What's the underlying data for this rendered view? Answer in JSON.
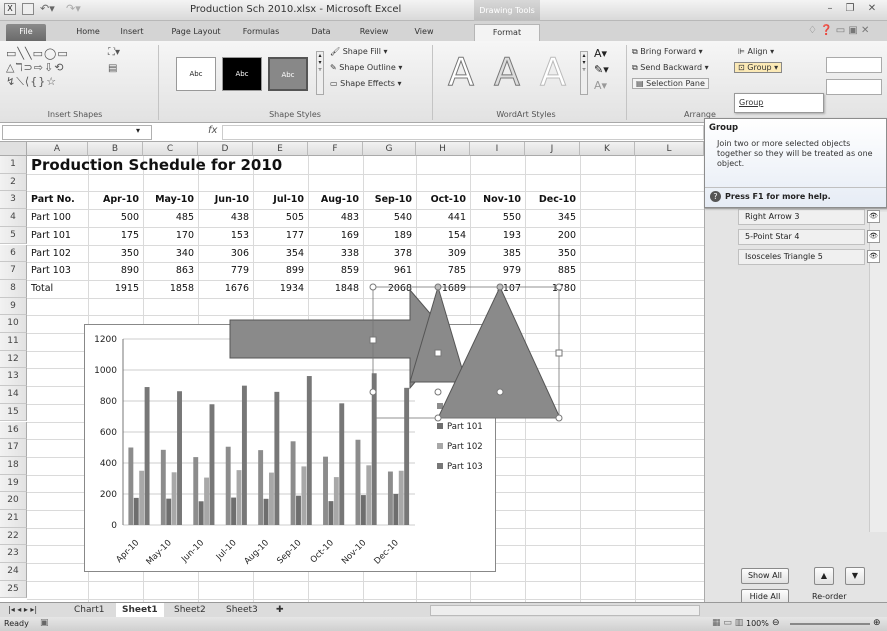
{
  "window": {
    "title": "Production Sch 2010.xlsx - Microsoft Excel",
    "contextual_tab_group": "Drawing Tools"
  },
  "tabs": [
    "File",
    "Home",
    "Insert",
    "Page Layout",
    "Formulas",
    "Data",
    "Review",
    "View",
    "Format"
  ],
  "ribbon": {
    "insert_shapes_label": "Insert Shapes",
    "shape_styles_label": "Shape Styles",
    "style_preset_text": "Abc",
    "shape_fill": "Shape Fill",
    "shape_outline": "Shape Outline",
    "shape_effects": "Shape Effects",
    "wordart_label": "WordArt Styles",
    "wordart_glyph": "A",
    "arrange_label": "Arrange",
    "bring_forward": "Bring Forward",
    "send_backward": "Send Backward",
    "selection_pane": "Selection Pane",
    "align": "Align",
    "group": "Group",
    "group_menu_item": "Group"
  },
  "tooltip": {
    "title": "Group",
    "body": "Join two or more selected objects together so they will be treated as one object.",
    "help": "Press F1 for more help."
  },
  "formula_bar": {
    "fx": "fx"
  },
  "columns": [
    "A",
    "B",
    "C",
    "D",
    "E",
    "F",
    "G",
    "H",
    "I",
    "J",
    "K",
    "L"
  ],
  "rows": [
    "1",
    "2",
    "3",
    "4",
    "5",
    "6",
    "7",
    "8",
    "9",
    "10",
    "11",
    "12",
    "13",
    "14",
    "15",
    "16",
    "17",
    "18",
    "19",
    "20",
    "21",
    "22",
    "23",
    "24",
    "25"
  ],
  "sheet": {
    "title": "Production Schedule for 2010",
    "headers": [
      "Part No.",
      "Apr-10",
      "May-10",
      "Jun-10",
      "Jul-10",
      "Aug-10",
      "Sep-10",
      "Oct-10",
      "Nov-10",
      "Dec-10"
    ],
    "data": [
      [
        "Part 100",
        "500",
        "485",
        "438",
        "505",
        "483",
        "540",
        "441",
        "550",
        "345"
      ],
      [
        "Part 101",
        "175",
        "170",
        "153",
        "177",
        "169",
        "189",
        "154",
        "193",
        "200"
      ],
      [
        "Part 102",
        "350",
        "340",
        "306",
        "354",
        "338",
        "378",
        "309",
        "385",
        "350"
      ],
      [
        "Part 103",
        "890",
        "863",
        "779",
        "899",
        "859",
        "961",
        "785",
        "979",
        "885"
      ],
      [
        "Total",
        "1915",
        "1858",
        "1676",
        "1934",
        "1848",
        "2068",
        "1689",
        "2107",
        "1780"
      ]
    ]
  },
  "chart_data": {
    "type": "bar",
    "categories": [
      "Apr-10",
      "May-10",
      "Jun-10",
      "Jul-10",
      "Aug-10",
      "Sep-10",
      "Oct-10",
      "Nov-10",
      "Dec-10"
    ],
    "series": [
      {
        "name": "Part 100",
        "values": [
          500,
          485,
          438,
          505,
          483,
          540,
          441,
          550,
          345
        ],
        "color": "#8c8c8c"
      },
      {
        "name": "Part 101",
        "values": [
          175,
          170,
          153,
          177,
          169,
          189,
          154,
          193,
          200
        ],
        "color": "#6e6e6e"
      },
      {
        "name": "Part 102",
        "values": [
          350,
          340,
          306,
          354,
          338,
          378,
          309,
          385,
          350
        ],
        "color": "#a8a8a8"
      },
      {
        "name": "Part 103",
        "values": [
          890,
          863,
          779,
          899,
          859,
          961,
          785,
          979,
          885
        ],
        "color": "#777777"
      }
    ],
    "yticks": [
      "0",
      "200",
      "400",
      "600",
      "800",
      "1000",
      "1200"
    ],
    "ylim": [
      0,
      1200
    ],
    "legend": "right",
    "grid": true
  },
  "selection_pane": {
    "items": [
      "Right Arrow 3",
      "5-Point Star 4",
      "Isosceles Triangle 5"
    ],
    "show_all": "Show All",
    "hide_all": "Hide All",
    "reorder": "Re-order"
  },
  "sheet_tabs": [
    "Chart1",
    "Sheet1",
    "Sheet2",
    "Sheet3"
  ],
  "status": {
    "ready": "Ready",
    "zoom": "100%"
  }
}
